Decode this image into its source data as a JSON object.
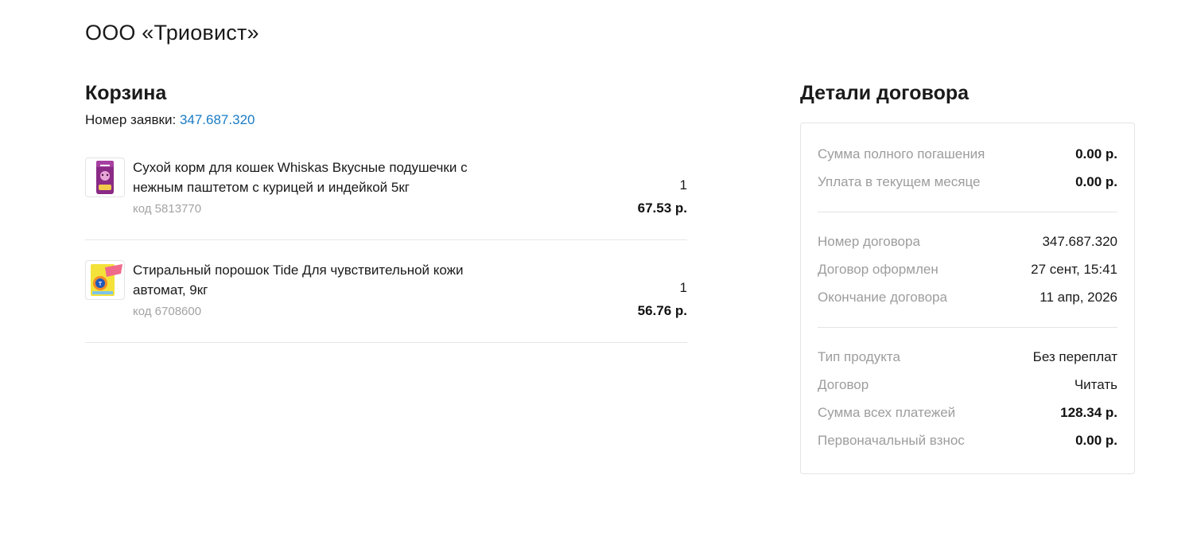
{
  "company": "ООО «Триовист»",
  "cart": {
    "title": "Корзина",
    "order_label": "Номер заявки:",
    "order_number": "347.687.320",
    "items": [
      {
        "name": "Сухой корм для кошек Whiskas Вкусные подушечки с нежным паштетом с курицей и индейкой 5кг",
        "code": "код 5813770",
        "qty": "1",
        "price": "67.53 р.",
        "thumb_icon": "cat-food-bag-icon"
      },
      {
        "name": "Стиральный порошок Tide Для чувствительной кожи автомат, 9кг",
        "code": "код 6708600",
        "qty": "1",
        "price": "56.76 р.",
        "thumb_icon": "detergent-box-icon"
      }
    ]
  },
  "details": {
    "title": "Детали договора",
    "groups": [
      [
        {
          "label": "Сумма полного погашения",
          "value": "0.00 р."
        },
        {
          "label": "Уплата в текущем месяце",
          "value": "0.00 р."
        }
      ],
      [
        {
          "label": "Номер договора",
          "value": "347.687.320"
        },
        {
          "label": "Договор оформлен",
          "value": "27 сент, 15:41"
        },
        {
          "label": "Окончание договора",
          "value": "11 апр, 2026"
        }
      ],
      [
        {
          "label": "Тип продукта",
          "value": "Без переплат"
        },
        {
          "label": "Договор",
          "value": "Читать"
        },
        {
          "label": "Сумма всех платежей",
          "value": "128.34 р."
        },
        {
          "label": "Первоначальный взнос",
          "value": "0.00 р."
        }
      ]
    ]
  },
  "colors": {
    "link": "#1a7bc4",
    "muted": "#9d9d9d",
    "border": "#e4e4e4"
  }
}
